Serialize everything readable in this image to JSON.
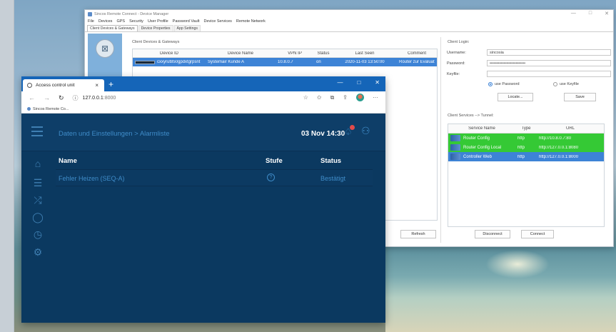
{
  "sincos": {
    "title": "Sincos Remote Connect - Device Manager",
    "menu": [
      "File",
      "Devices",
      "GPS",
      "Security",
      "User Profile",
      "Password Vault",
      "Device Services",
      "Remote Network"
    ],
    "tabs": [
      "Client Devices & Gateways",
      "Device Properties",
      "App Settings"
    ],
    "devices_group_label": "Client Devices & Gateways",
    "device_columns": [
      "Device ID",
      "Device Name",
      "VPN IP",
      "Status",
      "Last Seen",
      "Comment"
    ],
    "devices": [
      {
        "id": "cxxyrut850gpdxtgrpsnt",
        "name": "Systemair Kunde A",
        "vpn_ip": "10.8.0.7",
        "status": "on",
        "last_seen": "2020-11-03 13:50:00",
        "comment": "Router zur Evaluat"
      }
    ],
    "login_label": "Client Login:",
    "username_label": "Username:",
    "username_value": "sincosia",
    "password_label": "Password:",
    "password_value": "••••••••••••••••••••••••••",
    "keyfile_label": "Keyfile:",
    "use_password_label": "use Password",
    "use_keyfile_label": "use Keyfile",
    "locate_button": "Locate...",
    "save_button": "Save",
    "services_label": "Client Services --> Tunnel:",
    "service_columns": [
      "Service Name",
      "Type",
      "URL"
    ],
    "services": [
      {
        "name": "Router Config",
        "type": "http",
        "url": "http://10.8.0.7:80",
        "color": "#35c935"
      },
      {
        "name": "Router Config Local",
        "type": "http",
        "url": "http://127.0.0.1:8080",
        "color": "#35c935"
      },
      {
        "name": "Controller Web",
        "type": "http",
        "url": "http://127.0.0.1:8000",
        "color": "#3d83d6"
      }
    ],
    "refresh_button": "Refresh",
    "disconnect_button": "Disconnect",
    "connect_button": "Connect",
    "window_controls": [
      "—",
      "□",
      "✕"
    ]
  },
  "browser": {
    "tab_title": "Access control unit",
    "url_host": "127.0.0.1",
    "url_port": ":8000",
    "favorite": "Sincos Remote Co...",
    "window_controls": [
      "—",
      "□",
      "✕"
    ],
    "more": "···"
  },
  "app": {
    "breadcrumb": "Daten und Einstellungen > Alarmliste",
    "datetime": "03 Nov 14:30",
    "columns": {
      "name": "Name",
      "level": "Stufe",
      "status": "Status"
    },
    "rows": [
      {
        "name": "Fehler Heizen (SEQ-A)",
        "status": "Bestätigt"
      }
    ]
  }
}
